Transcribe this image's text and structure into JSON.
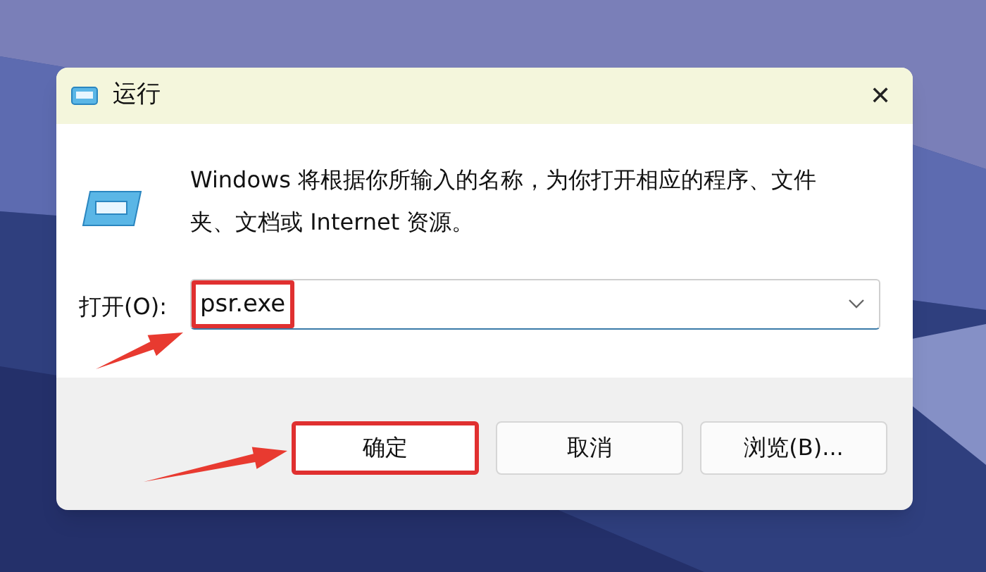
{
  "window": {
    "title": "运行",
    "close": "✕"
  },
  "description": "Windows 将根据你所输入的名称，为你打开相应的程序、文件夹、文档或 Internet 资源。",
  "open_field": {
    "label": "打开(O):",
    "value": "psr.exe",
    "highlighted": true
  },
  "buttons": [
    {
      "label": "确定",
      "highlighted": true
    },
    {
      "label": "取消",
      "highlighted": false
    },
    {
      "label": "浏览(B)...",
      "highlighted": false
    }
  ]
}
